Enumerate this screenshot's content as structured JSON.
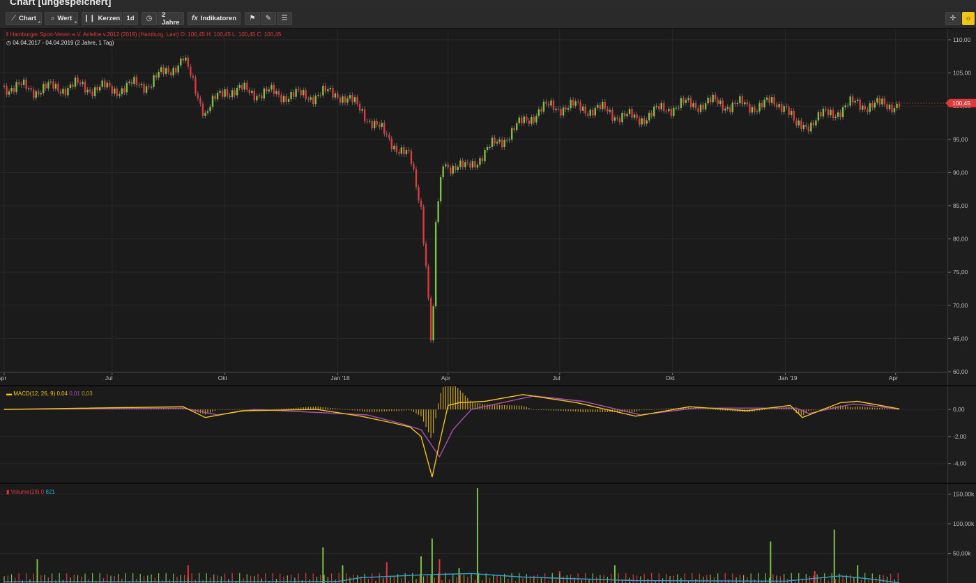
{
  "window": {
    "title": "Chart [ungespeichert]"
  },
  "toolbar": {
    "chart_label": "Chart",
    "wert_label": "Wert",
    "kerzen_label": "Kerzen",
    "interval_label": "1d",
    "range_label": "2 Jahre",
    "indikatoren_label": "Indikatoren"
  },
  "main": {
    "instrument_line": "Hamburger Sport-Verein e.V. Anleihe v.2012 (2019) (Hamburg, Last)  O: 100,45  H: 100,45  L: 100,45  C: 100,45",
    "period_line": "04.04.2017 - 04.04.2019  (2 Jahre, 1 Tag)",
    "last_price": "100,45"
  },
  "macd": {
    "label": "MACD(12, 26, 9)",
    "v1": "0,04",
    "v2": "0,01",
    "v3": "0,03"
  },
  "volume": {
    "label": "Volume(28)",
    "v1": "0",
    "v2": "821"
  },
  "colors": {
    "up": "#7cc142",
    "down": "#e2383b",
    "macd": "#f5c518",
    "signal": "#b04fb5",
    "volavg": "#2aa6d6",
    "accent": "#f0c419"
  },
  "chart_data": [
    {
      "type": "candlestick",
      "title": "Hamburger Sport-Verein e.V. Anleihe v.2012 (2019) (Hamburg, Last)",
      "x_ticks": [
        "Apr",
        "Jul",
        "Okt",
        "Jan '18",
        "Apr",
        "Jul",
        "Okt",
        "Jan '19",
        "Apr"
      ],
      "y_ticks": [
        "110,00",
        "105,00",
        "100,00",
        "95,00",
        "90,00",
        "85,00",
        "80,00",
        "75,00",
        "70,00",
        "65,00",
        "60,00"
      ],
      "ylim": [
        60,
        110
      ],
      "series": [
        {
          "name": "Kurs",
          "points": [
            [
              "2017-04-04",
              103.0
            ],
            [
              "2017-05-01",
              102.5
            ],
            [
              "2017-06-01",
              103.0
            ],
            [
              "2017-07-01",
              102.5
            ],
            [
              "2017-08-01",
              103.5
            ],
            [
              "2017-08-28",
              107.0
            ],
            [
              "2017-09-15",
              99.0
            ],
            [
              "2017-10-01",
              102.5
            ],
            [
              "2017-11-01",
              102.0
            ],
            [
              "2017-12-01",
              101.5
            ],
            [
              "2018-01-01",
              102.0
            ],
            [
              "2018-01-20",
              99.5
            ],
            [
              "2018-02-01",
              97.0
            ],
            [
              "2018-02-15",
              94.5
            ],
            [
              "2018-03-01",
              92.0
            ],
            [
              "2018-03-10",
              85.0
            ],
            [
              "2018-03-15",
              74.0
            ],
            [
              "2018-03-19",
              62.0
            ],
            [
              "2018-03-22",
              82.0
            ],
            [
              "2018-03-28",
              91.5
            ],
            [
              "2018-04-15",
              90.5
            ],
            [
              "2018-05-01",
              93.0
            ],
            [
              "2018-05-15",
              95.0
            ],
            [
              "2018-06-01",
              97.5
            ],
            [
              "2018-06-15",
              99.5
            ],
            [
              "2018-07-01",
              100.0
            ],
            [
              "2018-08-01",
              99.5
            ],
            [
              "2018-09-01",
              98.0
            ],
            [
              "2018-10-01",
              100.0
            ],
            [
              "2018-11-01",
              100.5
            ],
            [
              "2018-12-01",
              100.0
            ],
            [
              "2019-01-01",
              100.5
            ],
            [
              "2019-01-10",
              96.5
            ],
            [
              "2019-01-25",
              98.0
            ],
            [
              "2019-02-15",
              99.5
            ],
            [
              "2019-03-01",
              100.5
            ],
            [
              "2019-03-15",
              100.0
            ],
            [
              "2019-04-04",
              100.45
            ]
          ]
        }
      ]
    },
    {
      "type": "line",
      "title": "MACD(12, 26, 9)",
      "y_ticks": [
        "0,00",
        "-2,00",
        "-4,00"
      ],
      "ylim": [
        -5.2,
        1.5
      ],
      "series": [
        {
          "name": "MACD",
          "points": [
            [
              "2017-04-04",
              0.0
            ],
            [
              "2017-08-28",
              0.2
            ],
            [
              "2017-09-15",
              -0.6
            ],
            [
              "2017-10-15",
              -0.1
            ],
            [
              "2017-12-15",
              0.0
            ],
            [
              "2018-01-20",
              -0.5
            ],
            [
              "2018-02-15",
              -1.0
            ],
            [
              "2018-03-01",
              -1.3
            ],
            [
              "2018-03-10",
              -2.0
            ],
            [
              "2018-03-19",
              -5.0
            ],
            [
              "2018-03-25",
              -2.5
            ],
            [
              "2018-04-01",
              0.3
            ],
            [
              "2018-04-10",
              0.5
            ],
            [
              "2018-05-01",
              0.6
            ],
            [
              "2018-06-01",
              1.1
            ],
            [
              "2018-07-15",
              0.5
            ],
            [
              "2018-09-01",
              -0.5
            ],
            [
              "2018-10-15",
              0.2
            ],
            [
              "2018-12-01",
              -0.1
            ],
            [
              "2019-01-05",
              0.3
            ],
            [
              "2019-01-15",
              -0.6
            ],
            [
              "2019-02-15",
              0.5
            ],
            [
              "2019-03-01",
              0.6
            ],
            [
              "2019-04-04",
              0.04
            ]
          ]
        },
        {
          "name": "Signal",
          "points": [
            [
              "2017-04-04",
              0.0
            ],
            [
              "2017-08-28",
              0.1
            ],
            [
              "2017-09-25",
              -0.4
            ],
            [
              "2017-10-25",
              0.0
            ],
            [
              "2018-01-25",
              -0.4
            ],
            [
              "2018-02-20",
              -1.0
            ],
            [
              "2018-03-10",
              -1.5
            ],
            [
              "2018-03-25",
              -3.5
            ],
            [
              "2018-04-05",
              -1.5
            ],
            [
              "2018-04-20",
              0.0
            ],
            [
              "2018-05-15",
              0.5
            ],
            [
              "2018-06-10",
              1.0
            ],
            [
              "2018-07-20",
              0.6
            ],
            [
              "2018-09-05",
              -0.4
            ],
            [
              "2018-10-20",
              0.1
            ],
            [
              "2019-01-10",
              0.1
            ],
            [
              "2019-01-20",
              -0.3
            ],
            [
              "2019-02-25",
              0.4
            ],
            [
              "2019-03-10",
              0.3
            ],
            [
              "2019-04-04",
              0.01
            ]
          ]
        }
      ]
    },
    {
      "type": "bar",
      "title": "Volume(28)",
      "y_ticks": [
        "150,00k",
        "100,00k",
        "50,00k"
      ],
      "ylim": [
        0,
        160000
      ],
      "series": [
        {
          "name": "Volume",
          "points": [
            [
              "2017-05-01",
              40000
            ],
            [
              "2017-09-01",
              30000
            ],
            [
              "2017-12-20",
              60000
            ],
            [
              "2018-01-05",
              30000
            ],
            [
              "2018-02-10",
              35000
            ],
            [
              "2018-03-10",
              45000
            ],
            [
              "2018-03-19",
              75000
            ],
            [
              "2018-03-25",
              40000
            ],
            [
              "2018-04-10",
              25000
            ],
            [
              "2018-04-25",
              160000
            ],
            [
              "2018-07-01",
              20000
            ],
            [
              "2018-08-15",
              30000
            ],
            [
              "2018-12-20",
              70000
            ],
            [
              "2019-01-25",
              20000
            ],
            [
              "2019-02-10",
              90000
            ],
            [
              "2019-03-01",
              30000
            ]
          ]
        },
        {
          "name": "Durchschnitt",
          "points": [
            [
              "2017-04-04",
              2000
            ],
            [
              "2018-01-01",
              2500
            ],
            [
              "2018-01-20",
              9000
            ],
            [
              "2018-03-15",
              14000
            ],
            [
              "2018-04-20",
              16000
            ],
            [
              "2018-06-01",
              10000
            ],
            [
              "2018-09-01",
              4000
            ],
            [
              "2019-01-01",
              3000
            ],
            [
              "2019-02-15",
              12000
            ],
            [
              "2019-03-15",
              6000
            ],
            [
              "2019-04-04",
              0
            ]
          ]
        }
      ]
    }
  ]
}
